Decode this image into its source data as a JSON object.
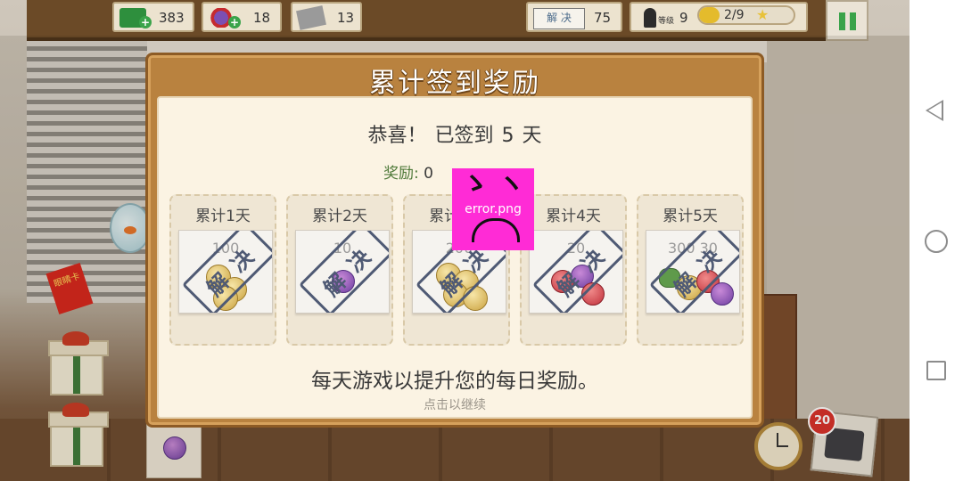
{
  "hud": {
    "cash": "383",
    "candy": "18",
    "newspaper": "13",
    "resolved_ticket_label": "解 决",
    "resolved": "75",
    "level_label": "等级",
    "level": "9",
    "progress_text": "2/9",
    "progress_fraction": 0.222
  },
  "scene": {
    "red_card_text": "眼睛卡",
    "register_badge": "20"
  },
  "dialog": {
    "title": "累计签到奖励",
    "congrats": "恭喜！ 已签到 5 天",
    "reward_label": "奖励:",
    "reward_value": "0",
    "error_image_text": "error.png",
    "tip": "每天游戏以提升您的每日奖励。",
    "continue": "点击以继续",
    "stamp_text": "解决",
    "days": [
      {
        "label": "累计1天",
        "amount": "100",
        "item": "coins"
      },
      {
        "label": "累计2天",
        "amount": "10",
        "item": "candy"
      },
      {
        "label": "累计3天",
        "amount": "200",
        "item": "coins"
      },
      {
        "label": "累计4天",
        "amount": "20",
        "item": "candy"
      },
      {
        "label": "累计5天",
        "amount": "300 30",
        "item": "mixed"
      }
    ]
  },
  "colors": {
    "dialog_frame": "#b9823f",
    "dialog_inner": "#fbf3e3",
    "stamp": "#4f5a74",
    "error_magenta": "#ff2bd6",
    "accent_green": "#3aa34a"
  }
}
